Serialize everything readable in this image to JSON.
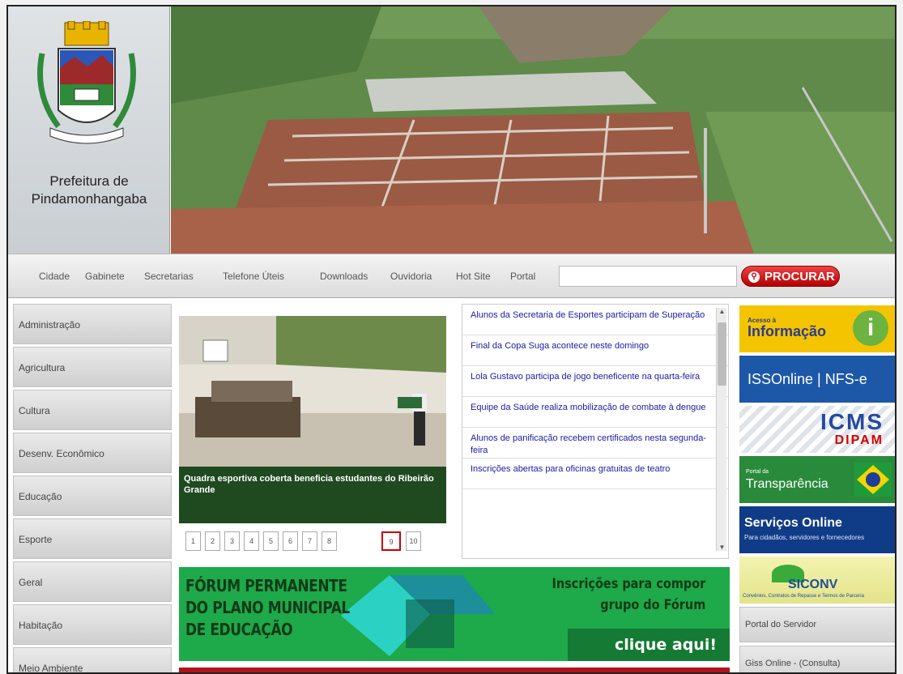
{
  "header": {
    "site_name_line1": "Prefeitura de",
    "site_name_line2": "Pindamonhangaba"
  },
  "nav": {
    "items": [
      "Cidade",
      "Gabinete",
      "Secretarias",
      "Telefone Úteis",
      "Downloads",
      "Ouvidoria",
      "Hot Site",
      "Portal"
    ],
    "search_button": "PROCURAR",
    "search_value": ""
  },
  "sidebar": {
    "items": [
      "Administração",
      "Agricultura",
      "Cultura",
      "Desenv. Econômico",
      "Educação",
      "Esporte",
      "Geral",
      "Habitação",
      "Meio Ambiente"
    ]
  },
  "slideshow": {
    "caption": "Quadra esportiva coberta beneficia estudantes do Ribeirão Grande",
    "pages": [
      "1",
      "2",
      "3",
      "4",
      "5",
      "6",
      "7",
      "8",
      "9",
      "10"
    ],
    "active_page": "9"
  },
  "news": {
    "items": [
      "Alunos da Secretaria de Esportes participam de Superação",
      "Final da Copa Suga acontece neste domingo",
      "Lola Gustavo participa de jogo beneficente na quarta-feira",
      "Equipe da Saúde realiza mobilização de combate à dengue",
      "Alunos de panificação recebem certificados nesta segunda-feira",
      "Inscrições abertas para oficinas gratuitas de teatro"
    ]
  },
  "forum_banner": {
    "title_line1": "FÓRUM PERMANENTE",
    "title_line2": "DO PLANO MUNICIPAL",
    "title_line3": "DE EDUCAÇÃO",
    "inscricoes_line1": "Inscrições para compor",
    "inscricoes_line2": "grupo do Fórum",
    "click": "clique aqui!"
  },
  "right_column": {
    "acesso_small": "Acesso à",
    "acesso_big": "Informação",
    "acesso_icon": "i",
    "iss": "ISSOnline | NFS-e",
    "icms_line1": "ICMS",
    "icms_line2": "DIPAM",
    "transparencia_small": "Portal da",
    "transparencia_big": "Transparência",
    "servicos_big": "Serviços Online",
    "servicos_small": "Para cidadãos, servidores e fornecedores",
    "siconv_big": "SICONV",
    "siconv_small": "Convênios, Contratos de Repasse e Termos de Parceria",
    "portal_servidor": "Portal do Servidor",
    "giss": "Giss Online - (Consulta)"
  },
  "colors": {
    "search_red": "#c00000",
    "forum_green": "#1ea94a",
    "news_link": "#1a1aa6"
  }
}
